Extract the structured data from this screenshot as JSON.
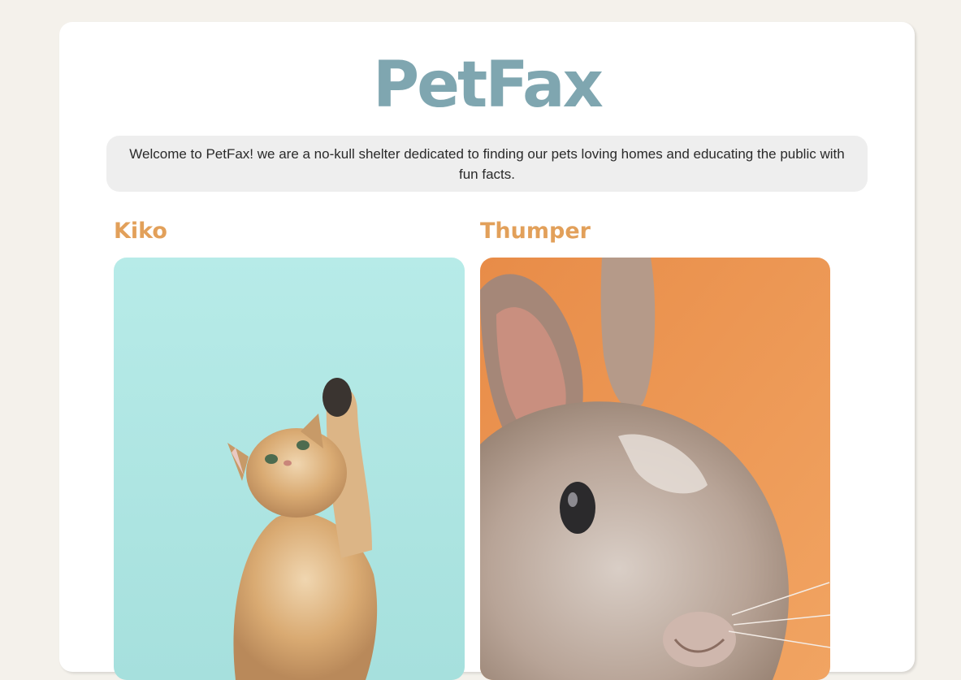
{
  "site": {
    "title": "PetFax",
    "welcome": "Welcome to PetFax! we are a no-kull shelter dedicated to finding our pets loving homes and educating the public with fun facts."
  },
  "pets": [
    {
      "name": "Kiko",
      "photo": "kitten-photo"
    },
    {
      "name": "Thumper",
      "photo": "bunny-photo"
    }
  ],
  "colors": {
    "background": "#f4f1eb",
    "card": "#ffffff",
    "title": "#7fa6b0",
    "pet_name": "#e2a05a",
    "welcome_box": "#eeeeee"
  }
}
